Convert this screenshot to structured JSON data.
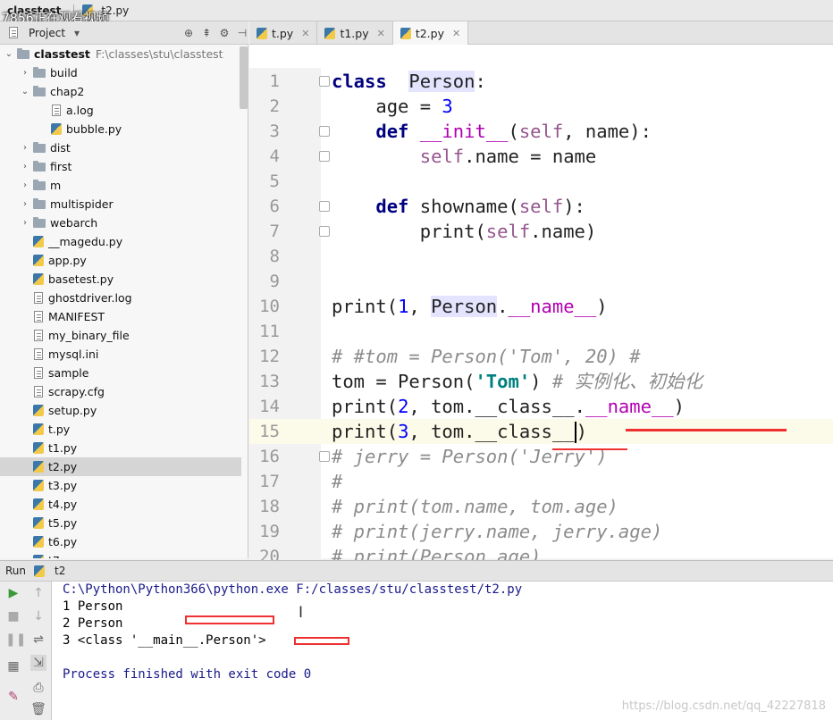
{
  "topbar": {
    "project": "classtest",
    "file": "t2.py",
    "overlay_text": "7856正在观看视频"
  },
  "project_panel": {
    "title": "Project",
    "root": {
      "name": "classtest",
      "path": "F:\\classes\\stu\\classtest"
    },
    "items": [
      {
        "label": "build",
        "kind": "folder",
        "depth": 1,
        "expanded": false
      },
      {
        "label": "chap2",
        "kind": "folder",
        "depth": 1,
        "expanded": true
      },
      {
        "label": "a.log",
        "kind": "file",
        "depth": 2
      },
      {
        "label": "bubble.py",
        "kind": "py",
        "depth": 2
      },
      {
        "label": "dist",
        "kind": "folder",
        "depth": 1,
        "expanded": false
      },
      {
        "label": "first",
        "kind": "folder",
        "depth": 1,
        "expanded": false
      },
      {
        "label": "m",
        "kind": "folder",
        "depth": 1,
        "expanded": false
      },
      {
        "label": "multispider",
        "kind": "folder",
        "depth": 1,
        "expanded": false
      },
      {
        "label": "webarch",
        "kind": "folder",
        "depth": 1,
        "expanded": false
      },
      {
        "label": "__magedu.py",
        "kind": "py",
        "depth": 1
      },
      {
        "label": "app.py",
        "kind": "py",
        "depth": 1
      },
      {
        "label": "basetest.py",
        "kind": "py",
        "depth": 1
      },
      {
        "label": "ghostdriver.log",
        "kind": "file",
        "depth": 1
      },
      {
        "label": "MANIFEST",
        "kind": "file",
        "depth": 1
      },
      {
        "label": "my_binary_file",
        "kind": "file",
        "depth": 1
      },
      {
        "label": "mysql.ini",
        "kind": "file",
        "depth": 1
      },
      {
        "label": "sample",
        "kind": "file",
        "depth": 1
      },
      {
        "label": "scrapy.cfg",
        "kind": "file",
        "depth": 1
      },
      {
        "label": "setup.py",
        "kind": "py",
        "depth": 1
      },
      {
        "label": "t.py",
        "kind": "py",
        "depth": 1
      },
      {
        "label": "t1.py",
        "kind": "py",
        "depth": 1
      },
      {
        "label": "t2.py",
        "kind": "py",
        "depth": 1,
        "selected": true
      },
      {
        "label": "t3.py",
        "kind": "py",
        "depth": 1
      },
      {
        "label": "t4.py",
        "kind": "py",
        "depth": 1
      },
      {
        "label": "t5.py",
        "kind": "py",
        "depth": 1
      },
      {
        "label": "t6.py",
        "kind": "py",
        "depth": 1
      },
      {
        "label": "t7",
        "kind": "py",
        "depth": 1
      }
    ]
  },
  "tabs": [
    {
      "label": "t.py",
      "active": false
    },
    {
      "label": "t1.py",
      "active": false
    },
    {
      "label": "t2.py",
      "active": true
    }
  ],
  "editor": {
    "current_line": 15,
    "lines": [
      {
        "n": "1",
        "tokens": [
          [
            "kw",
            "class"
          ],
          [
            "",
            "  "
          ],
          [
            "hl",
            "Person"
          ],
          [
            "",
            ":"
          ]
        ]
      },
      {
        "n": "2",
        "tokens": [
          [
            "",
            "    age = "
          ],
          [
            "num",
            "3"
          ]
        ]
      },
      {
        "n": "3",
        "tokens": [
          [
            "",
            "    "
          ],
          [
            "kw",
            "def"
          ],
          [
            "",
            " "
          ],
          [
            "magic",
            "__init__"
          ],
          [
            "",
            "("
          ],
          [
            "self",
            "self"
          ],
          [
            "",
            ", name):"
          ]
        ]
      },
      {
        "n": "4",
        "tokens": [
          [
            "",
            "        "
          ],
          [
            "self",
            "self"
          ],
          [
            "",
            ".name = name"
          ]
        ]
      },
      {
        "n": "5",
        "tokens": []
      },
      {
        "n": "6",
        "tokens": [
          [
            "",
            "    "
          ],
          [
            "kw",
            "def"
          ],
          [
            "",
            " showname("
          ],
          [
            "self",
            "self"
          ],
          [
            "",
            "):"
          ]
        ]
      },
      {
        "n": "7",
        "tokens": [
          [
            "",
            "        print("
          ],
          [
            "self",
            "self"
          ],
          [
            "",
            ".name)"
          ]
        ]
      },
      {
        "n": "8",
        "tokens": []
      },
      {
        "n": "9",
        "tokens": []
      },
      {
        "n": "10",
        "tokens": [
          [
            "",
            "print("
          ],
          [
            "num",
            "1"
          ],
          [
            "",
            ", "
          ],
          [
            "hl",
            "Person"
          ],
          [
            "",
            "."
          ],
          [
            "magic",
            "__name__"
          ],
          [
            "",
            ")"
          ]
        ]
      },
      {
        "n": "11",
        "tokens": []
      },
      {
        "n": "12",
        "tokens": [
          [
            "cm",
            "# #tom = Person('Tom', 20) #"
          ]
        ]
      },
      {
        "n": "13",
        "tokens": [
          [
            "",
            "tom = Person("
          ],
          [
            "str",
            "'Tom'"
          ],
          [
            "",
            ") "
          ],
          [
            "cm",
            "# 实例化、初始化"
          ]
        ]
      },
      {
        "n": "14",
        "tokens": [
          [
            "",
            "print("
          ],
          [
            "num",
            "2"
          ],
          [
            "",
            ", tom."
          ],
          [
            "",
            "__class__"
          ],
          [
            "",
            "."
          ],
          [
            "magic",
            "__name__"
          ],
          [
            "",
            ")"
          ]
        ]
      },
      {
        "n": "15",
        "tokens": [
          [
            "",
            "print("
          ],
          [
            "num",
            "3"
          ],
          [
            "",
            ", tom."
          ],
          [
            "",
            "__class__"
          ],
          [
            "caret",
            ""
          ],
          [
            "",
            ")"
          ]
        ]
      },
      {
        "n": "16",
        "tokens": [
          [
            "cm",
            "# jerry = Person('Jerry')"
          ]
        ]
      },
      {
        "n": "17",
        "tokens": [
          [
            "cm",
            "#"
          ]
        ]
      },
      {
        "n": "18",
        "tokens": [
          [
            "cm",
            "# print(tom.name, tom.age)"
          ]
        ]
      },
      {
        "n": "19",
        "tokens": [
          [
            "cm",
            "# print(jerry.name, jerry.age)"
          ]
        ]
      },
      {
        "n": "20",
        "tokens": [
          [
            "cm",
            "# print(Person.age)"
          ]
        ]
      }
    ]
  },
  "run": {
    "label": "Run",
    "config": "t2",
    "output": {
      "command": "C:\\Python\\Python366\\python.exe F:/classes/stu/classtest/t2.py",
      "line1": "1 Person",
      "line2": "2 Person",
      "line3": "3 <class '__main__.Person'>",
      "exit": "Process finished with exit code 0"
    }
  },
  "watermark": "https://blog.csdn.net/qq_42227818",
  "colors": {
    "annotation_red": "#f03030",
    "keyword": "#000080",
    "self": "#94558d",
    "comment": "#8c8c8c"
  }
}
